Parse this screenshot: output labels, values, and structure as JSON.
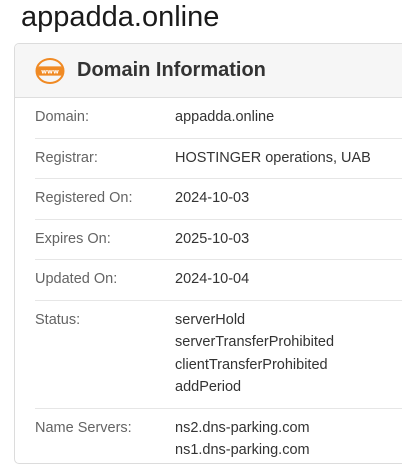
{
  "page": {
    "title": "appadda.online"
  },
  "card": {
    "title": "Domain Information",
    "icon": "www-icon",
    "accent_color": "#f08a24"
  },
  "rows": {
    "domain": {
      "label": "Domain:",
      "value": "appadda.online"
    },
    "registrar": {
      "label": "Registrar:",
      "value": "HOSTINGER operations, UAB"
    },
    "registered": {
      "label": "Registered On:",
      "value": "2024-10-03"
    },
    "expires": {
      "label": "Expires On:",
      "value": "2025-10-03"
    },
    "updated": {
      "label": "Updated On:",
      "value": "2024-10-04"
    },
    "status": {
      "label": "Status:",
      "values": [
        "serverHold",
        "serverTransferProhibited",
        "clientTransferProhibited",
        "addPeriod"
      ]
    },
    "nameservers": {
      "label": "Name Servers:",
      "values": [
        "ns2.dns-parking.com",
        "ns1.dns-parking.com"
      ]
    }
  }
}
